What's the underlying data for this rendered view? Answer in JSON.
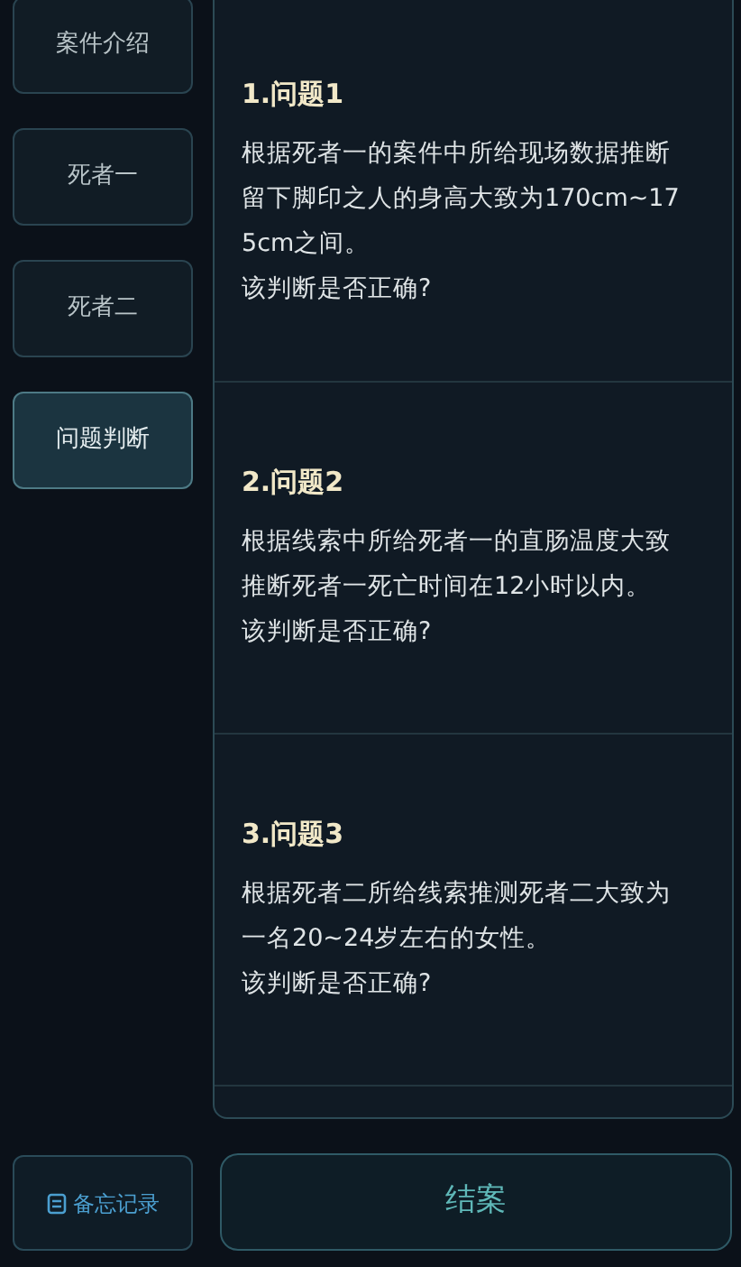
{
  "tabs": [
    {
      "label": "案件介绍",
      "selected": false
    },
    {
      "label": "死者一",
      "selected": false
    },
    {
      "label": "死者二",
      "selected": false
    },
    {
      "label": "问题判断",
      "selected": true
    }
  ],
  "questions": [
    {
      "title": "1.问题1",
      "statement": "根据死者一的案件中所给现场数据推断留下脚印之人的身高大致为170cm~175cm之间。",
      "prompt": "该判断是否正确?"
    },
    {
      "title": "2.问题2",
      "statement": "根据线索中所给死者一的直肠温度大致推断死者一死亡时间在12小时以内。",
      "prompt": "该判断是否正确?"
    },
    {
      "title": "3.问题3",
      "statement": "根据死者二所给线索推测死者二大致为一名20~24岁左右的女性。",
      "prompt": "该判断是否正确?"
    }
  ],
  "memo_button": {
    "label": "备忘记录"
  },
  "close_case_button": {
    "label": "结案"
  }
}
